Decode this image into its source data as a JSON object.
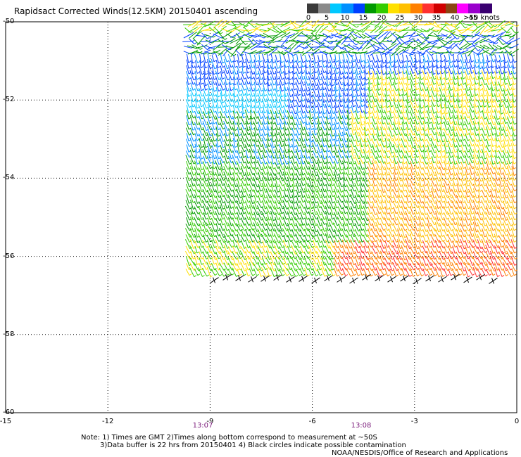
{
  "title": "Rapidsact Corrected Winds(12.5KM) 20150401 ascending",
  "colorbar": {
    "colors": [
      "#3a3a3a",
      "#8a8a8a",
      "#00c8ff",
      "#0090ff",
      "#0040ff",
      "#009900",
      "#33cc00",
      "#ffe000",
      "#ffc000",
      "#ff8000",
      "#ff3030",
      "#d00000",
      "#8b4513",
      "#ff00ff",
      "#9900cc",
      "#3a0070"
    ],
    "labels": [
      "0",
      "5",
      "10",
      "15",
      "20",
      "25",
      "30",
      "35",
      "40",
      "45",
      ">50 knots"
    ]
  },
  "map": {
    "lon_range": [
      -15,
      0
    ],
    "lat_range": [
      -60,
      -50
    ],
    "y_ticks": [
      "-50",
      "-52",
      "-54",
      "-56",
      "-58",
      "-60"
    ],
    "x_ticks": [
      "-15",
      "-12",
      "-9",
      "-6",
      "-3",
      "0"
    ],
    "time_labels": [
      "13:07",
      "13:08"
    ],
    "swath": {
      "lon_west": -9.7,
      "lon_east": 0,
      "lat_north": -50,
      "lat_south": -56.6
    }
  },
  "notes": {
    "line1": "Note: 1) Times are GMT 2)Times along bottom correspond to measurement at ~50S",
    "line2": "3)Data buffer is 22 hrs from 20150401 4) Black circles indicate possible contamination",
    "line3": "NOAA/NESDIS/Office of Research and Applications"
  }
}
